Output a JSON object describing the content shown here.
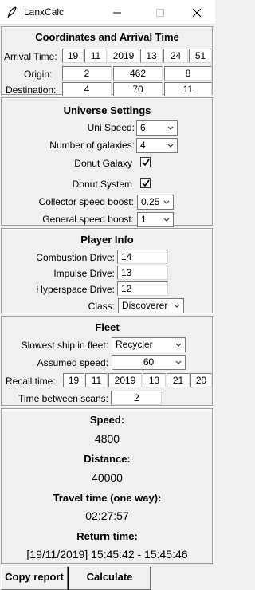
{
  "window": {
    "title": "LanxCalc"
  },
  "coords": {
    "heading": "Coordinates and Arrival Time",
    "arrival_label": "Arrival Time:",
    "arrival": [
      "19",
      "11",
      "2019",
      "13",
      "24",
      "51"
    ],
    "origin_label": "Origin:",
    "origin": [
      "2",
      "462",
      "8"
    ],
    "destination_label": "Destination:",
    "destination": [
      "4",
      "70",
      "11"
    ]
  },
  "universe": {
    "heading": "Universe Settings",
    "uni_speed_label": "Uni Speed:",
    "uni_speed": "6",
    "galaxies_label": "Number of galaxies:",
    "galaxies": "4",
    "donut_galaxy_label": "Donut Galaxy",
    "donut_galaxy_checked": true,
    "donut_system_label": "Donut System",
    "donut_system_checked": true,
    "collector_label": "Collector speed boost:",
    "collector": "0.25",
    "general_label": "General speed boost:",
    "general": "1"
  },
  "player": {
    "heading": "Player Info",
    "combustion_label": "Combustion Drive:",
    "combustion": "14",
    "impulse_label": "Impulse Drive:",
    "impulse": "13",
    "hyperspace_label": "Hyperspace Drive:",
    "hyperspace": "12",
    "class_label": "Class:",
    "class": "Discoverer"
  },
  "fleet": {
    "heading": "Fleet",
    "slowest_label": "Slowest ship in fleet:",
    "slowest": "Recycler",
    "assumed_label": "Assumed speed:",
    "assumed": "60",
    "recall_label": "Recall time:",
    "recall": [
      "19",
      "11",
      "2019",
      "13",
      "21",
      "20"
    ],
    "scans_label": "Time between scans:",
    "scans": "2"
  },
  "results": {
    "speed_label": "Speed:",
    "speed": "4800",
    "distance_label": "Distance:",
    "distance": "40000",
    "travel_label": "Travel time (one way):",
    "travel": "02:27:57",
    "return_label": "Return time:",
    "return": "[19/11/2019] 15:45:42 - 15:45:46"
  },
  "buttons": {
    "copy": "Copy report",
    "calculate": "Calculate"
  }
}
